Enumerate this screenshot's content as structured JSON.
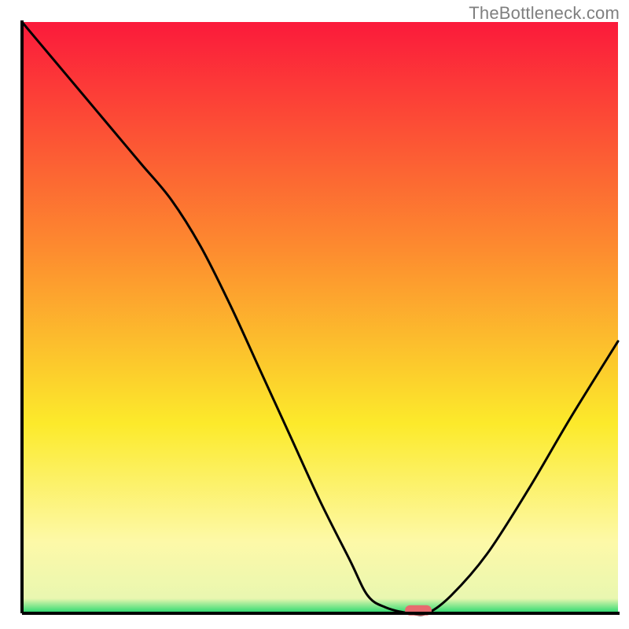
{
  "watermark": "TheBottleneck.com",
  "colors": {
    "gradient_top": "#fb1a3b",
    "gradient_mid1": "#fd8a2f",
    "gradient_mid2": "#fcea2b",
    "gradient_pale": "#fdf9a8",
    "gradient_green": "#22d86d",
    "curve_stroke": "#000000",
    "axis_stroke": "#000000",
    "marker_fill": "#e86a6f"
  },
  "chart_data": {
    "type": "line",
    "title": "",
    "xlabel": "",
    "ylabel": "",
    "xlim": [
      0,
      100
    ],
    "ylim": [
      0,
      100
    ],
    "x": [
      0,
      5,
      10,
      15,
      20,
      25,
      30,
      35,
      40,
      45,
      50,
      55,
      58,
      61,
      65,
      68,
      72,
      78,
      85,
      92,
      100
    ],
    "y": [
      100,
      94,
      88,
      82,
      76,
      70,
      62,
      52,
      41,
      30,
      19,
      9,
      3,
      1,
      0,
      0,
      3,
      10,
      21,
      33,
      46
    ],
    "marker": {
      "x": 66.5,
      "y": 0.5
    }
  }
}
